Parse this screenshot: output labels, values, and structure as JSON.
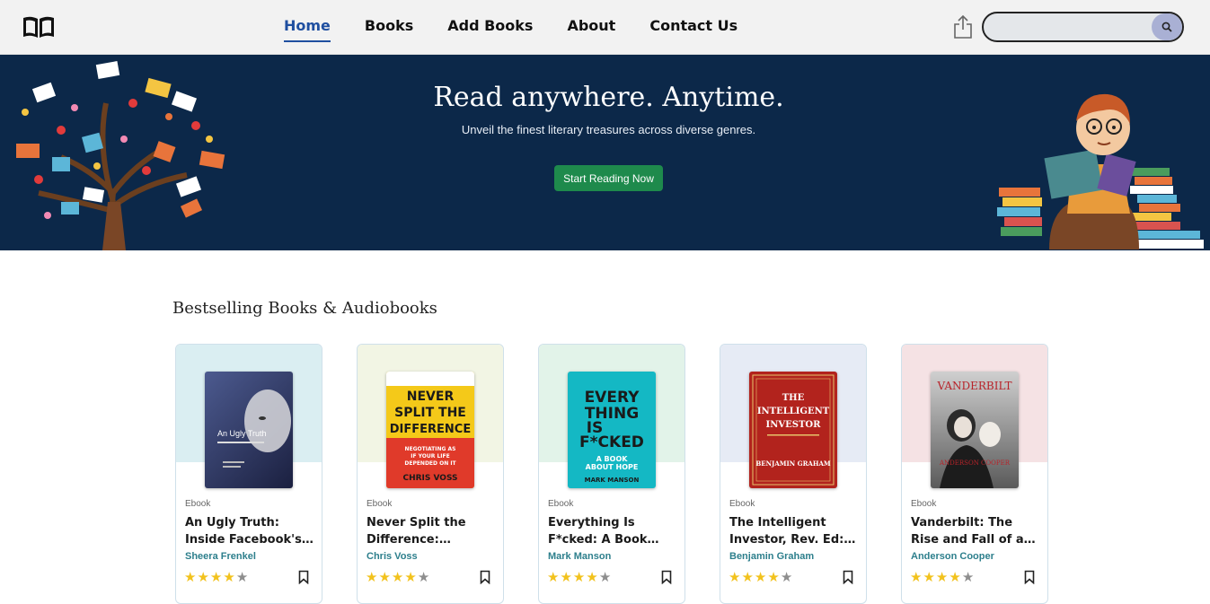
{
  "nav": {
    "links": [
      "Home",
      "Books",
      "Add Books",
      "About",
      "Contact Us"
    ],
    "active": "Home",
    "search_placeholder": ""
  },
  "hero": {
    "title": "Read anywhere. Anytime.",
    "subtitle": "Unveil the finest literary treasures across diverse genres.",
    "cta": "Start Reading Now"
  },
  "section": {
    "title": "Bestselling Books & Audiobooks"
  },
  "books": [
    {
      "type": "Ebook",
      "title": "An Ugly Truth: Inside Facebook's Battle for Domination",
      "author": "Sheera Frenkel",
      "rating": 4,
      "top_color": "#daeef2",
      "cover_text": "An Ugly Truth"
    },
    {
      "type": "Ebook",
      "title": "Never Split the Difference: Negotiating As If Your Life Depended On It",
      "author": "Chris Voss",
      "rating": 4,
      "top_color": "#f2f5e4",
      "cover_text": "NEVER SPLIT THE DIFFERENCE"
    },
    {
      "type": "Ebook",
      "title": "Everything Is F*cked: A Book About Hope",
      "author": "Mark Manson",
      "rating": 4,
      "top_color": "#e2f3e9",
      "cover_text": "EVERY THING IS F*CKED"
    },
    {
      "type": "Ebook",
      "title": "The Intelligent Investor, Rev. Ed: The Definitive Book on Value Investing",
      "author": "Benjamin Graham",
      "rating": 4,
      "top_color": "#e6ebf5",
      "cover_text": "THE INTELLIGENT INVESTOR"
    },
    {
      "type": "Ebook",
      "title": "Vanderbilt: The Rise and Fall of an American Dynasty",
      "author": "Anderson Cooper",
      "rating": 4,
      "top_color": "#f5e2e4",
      "cover_text": "VANDERBILT"
    }
  ],
  "colors": {
    "nav_bg": "#f2f2f2",
    "hero_bg": "#0c2849",
    "active_link": "#1f4fa0",
    "cta": "#1e8a4c",
    "author": "#2d7f8c",
    "star": "#f2c21d"
  },
  "icons": [
    "book-logo-icon",
    "share-upload-icon",
    "search-icon",
    "bookmark-icon",
    "star-icon"
  ]
}
